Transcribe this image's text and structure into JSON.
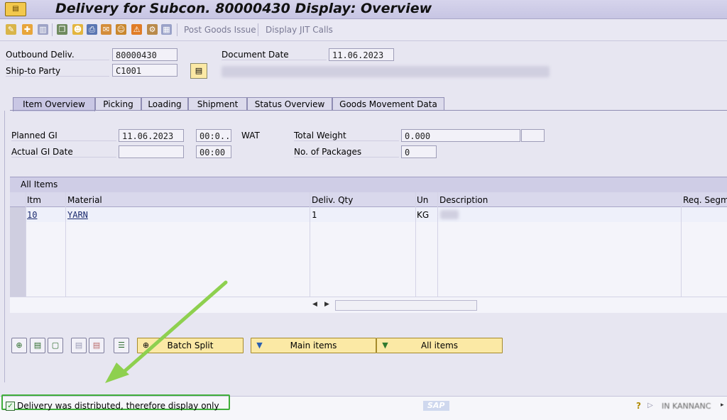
{
  "window": {
    "title": "Delivery for Subcon. 80000430 Display: Overview"
  },
  "toolbar": {
    "icons": [
      "tool-icon",
      "new-icon",
      "trash-icon",
      "copy-icon",
      "partner-icon",
      "print-icon",
      "output-icon",
      "person-icon",
      "warning-icon",
      "settings-icon",
      "grid-icon"
    ],
    "post_goods_issue": "Post Goods Issue",
    "display_jit_calls": "Display JIT Calls"
  },
  "header": {
    "outbound_deliv_label": "Outbound Deliv.",
    "outbound_deliv_value": "80000430",
    "ship_to_label": "Ship-to Party",
    "ship_to_value": "C1001",
    "document_date_label": "Document Date",
    "document_date_value": "11.06.2023"
  },
  "tabs": [
    {
      "label": "Item Overview",
      "active": true
    },
    {
      "label": "Picking"
    },
    {
      "label": "Loading"
    },
    {
      "label": "Shipment"
    },
    {
      "label": "Status Overview"
    },
    {
      "label": "Goods Movement Data"
    }
  ],
  "gi": {
    "planned_gi_label": "Planned GI",
    "planned_gi_date": "11.06.2023",
    "planned_gi_time": "00:0...",
    "planned_gi_unit": "WAT",
    "actual_gi_label": "Actual GI Date",
    "actual_gi_date": "",
    "actual_gi_time": "00:00",
    "total_weight_label": "Total Weight",
    "total_weight_value": "0.000",
    "packages_label": "No. of Packages",
    "packages_value": "0"
  },
  "items_table": {
    "title": "All Items",
    "columns": [
      "Itm",
      "Material",
      "Deliv. Qty",
      "Un",
      "Description",
      "Req. Segm"
    ],
    "rows": [
      {
        "itm": "10",
        "material": "YARN",
        "qty": "1",
        "un": "KG"
      }
    ]
  },
  "buttons": {
    "batch_split": "Batch Split",
    "main_items": "Main items",
    "all_items": "All items"
  },
  "status": {
    "message": "Delivery was distributed, therefore display only",
    "logo": "SAP",
    "system": "IN  KANNANC"
  },
  "colors": {
    "highlight": "#3fae3a",
    "button_yellow": "#fbe9a5",
    "title_bg": "#c7c5e3"
  }
}
